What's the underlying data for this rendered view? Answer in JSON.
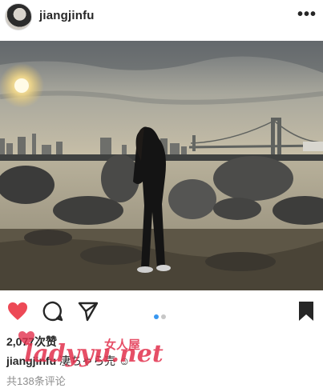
{
  "post": {
    "username": "jiangjinfu",
    "more_glyph": "•••",
    "avatar_icon": "user-avatar",
    "photo_alt": "person standing on rocky shore at sunset with city skyline and bridge",
    "carousel": {
      "count": 2,
      "active": 0,
      "active_color": "#3897f0",
      "inactive_color": "#c7c7c7"
    },
    "likes_label": "2,077次赞",
    "caption_user": "jiangjinfu",
    "caption_text": " 凄ちゃら売 ☺",
    "comments_label": "共138条评论",
    "like_color": "#ed4956",
    "icons": [
      "heart-icon",
      "comment-icon",
      "share-icon",
      "bookmark-icon"
    ]
  },
  "watermark": {
    "site": "ladyyu.net",
    "label": "女人屋"
  }
}
